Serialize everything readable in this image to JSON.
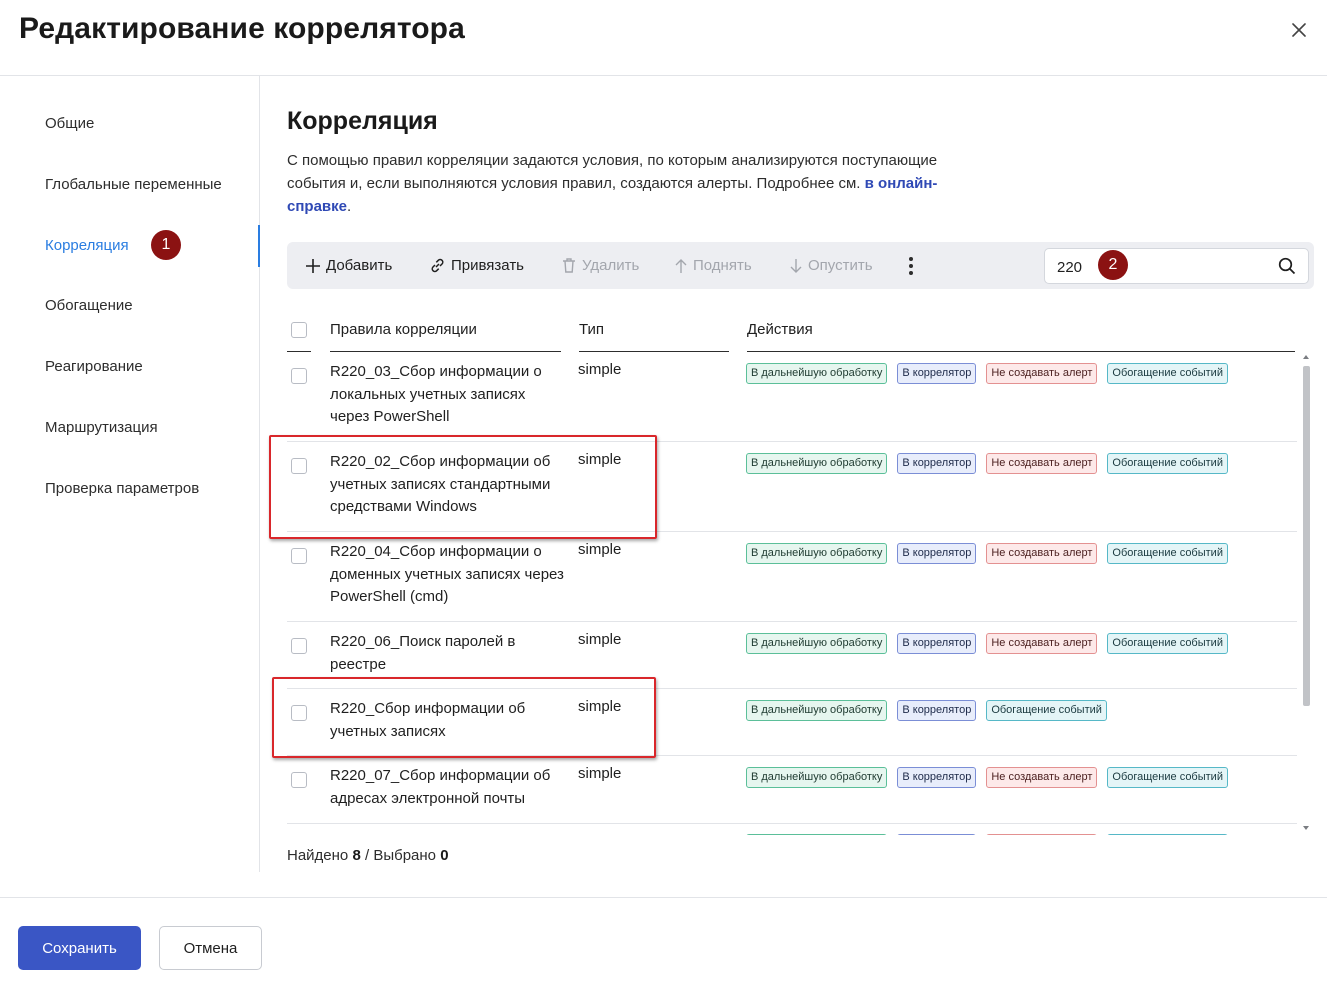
{
  "dialog": {
    "title": "Редактирование коррелятора",
    "close_icon": "close-icon"
  },
  "sidebar": {
    "items": [
      {
        "label": "Общие",
        "active": false
      },
      {
        "label": "Глобальные переменные",
        "active": false
      },
      {
        "label": "Корреляция",
        "active": true
      },
      {
        "label": "Обогащение",
        "active": false
      },
      {
        "label": "Реагирование",
        "active": false
      },
      {
        "label": "Маршрутизация",
        "active": false
      },
      {
        "label": "Проверка параметров",
        "active": false
      }
    ],
    "accent_color": "#2a7de1"
  },
  "markers": {
    "m1": "1",
    "m2": "2",
    "color": "#8b1212"
  },
  "main": {
    "title": "Корреляция",
    "description": "С помощью правил корреляции задаются условия, по которым анализируются поступающие события и, если выполняются условия правил, создаются алерты. Подробнее см.",
    "link_text": "в онлайн-справке",
    "desc_end": "."
  },
  "toolbar": {
    "add": "Добавить",
    "bind": "Привязать",
    "delete": "Удалить",
    "up": "Поднять",
    "down": "Опустить",
    "more_icon": "more-vertical-icon"
  },
  "search": {
    "value": "220",
    "placeholder": "",
    "icon": "search-icon"
  },
  "table": {
    "headers": {
      "name": "Правила корреляции",
      "type": "Тип",
      "actions": "Действия"
    },
    "rows": [
      {
        "name": "R220_03_Сбор информации о локальных учетных записях через PowerShell",
        "type": "simple",
        "tags": [
          "В дальнейшую обработку",
          "В коррелятор",
          "Не создавать алерт",
          "Обогащение событий"
        ]
      },
      {
        "name": "R220_02_Сбор информации об учетных записях стандартными средствами Windows",
        "type": "simple",
        "tags": [
          "В дальнейшую обработку",
          "В коррелятор",
          "Не создавать алерт",
          "Обогащение событий"
        ]
      },
      {
        "name": "R220_04_Сбор информации о доменных учетных записях через PowerShell (cmd)",
        "type": "simple",
        "tags": [
          "В дальнейшую обработку",
          "В коррелятор",
          "Не создавать алерт",
          "Обогащение событий"
        ]
      },
      {
        "name": "R220_06_Поиск паролей в реестре",
        "type": "simple",
        "tags": [
          "В дальнейшую обработку",
          "В коррелятор",
          "Не создавать алерт",
          "Обогащение событий"
        ]
      },
      {
        "name": "R220_Сбор информации об учетных записях",
        "type": "simple",
        "tags": [
          "В дальнейшую обработку",
          "В коррелятор",
          "Обогащение событий"
        ]
      },
      {
        "name": "R220_07_Сбор информации об адресах электронной почты",
        "type": "simple",
        "tags": [
          "В дальнейшую обработку",
          "В коррелятор",
          "Не создавать алерт",
          "Обогащение событий"
        ]
      }
    ]
  },
  "status": {
    "found_label": "Найдено",
    "found": "8",
    "sep": "/",
    "selected_label": "Выбрано",
    "selected": "0"
  },
  "footer": {
    "save": "Сохранить",
    "cancel": "Отмена",
    "primary_color": "#3a56c5"
  }
}
